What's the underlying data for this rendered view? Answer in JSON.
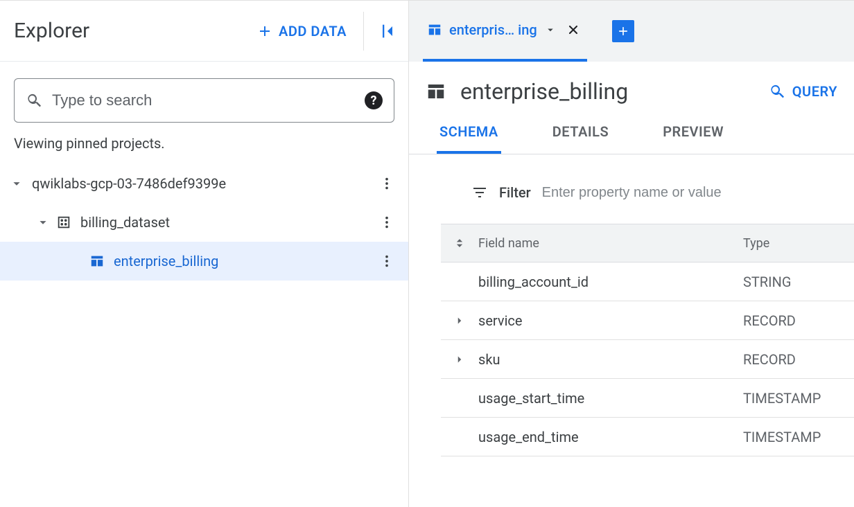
{
  "explorer": {
    "title": "Explorer",
    "add_data_label": "ADD DATA",
    "search_placeholder": "Type to search",
    "pinned_note": "Viewing pinned projects."
  },
  "tree": {
    "project": {
      "label": "qwiklabs-gcp-03-7486def9399e"
    },
    "dataset": {
      "label": "billing_dataset"
    },
    "table": {
      "label": "enterprise_billing"
    }
  },
  "doc_tab": {
    "label": "enterpris… ing"
  },
  "object": {
    "title": "enterprise_billing",
    "query_label": "QUERY"
  },
  "subtabs": {
    "schema": "SCHEMA",
    "details": "DETAILS",
    "preview": "PREVIEW"
  },
  "filter": {
    "label": "Filter",
    "placeholder": "Enter property name or value"
  },
  "schema": {
    "head_name": "Field name",
    "head_type": "Type",
    "rows": [
      {
        "expandable": false,
        "name": "billing_account_id",
        "type": "STRING"
      },
      {
        "expandable": true,
        "name": "service",
        "type": "RECORD"
      },
      {
        "expandable": true,
        "name": "sku",
        "type": "RECORD"
      },
      {
        "expandable": false,
        "name": "usage_start_time",
        "type": "TIMESTAMP"
      },
      {
        "expandable": false,
        "name": "usage_end_time",
        "type": "TIMESTAMP"
      }
    ]
  }
}
